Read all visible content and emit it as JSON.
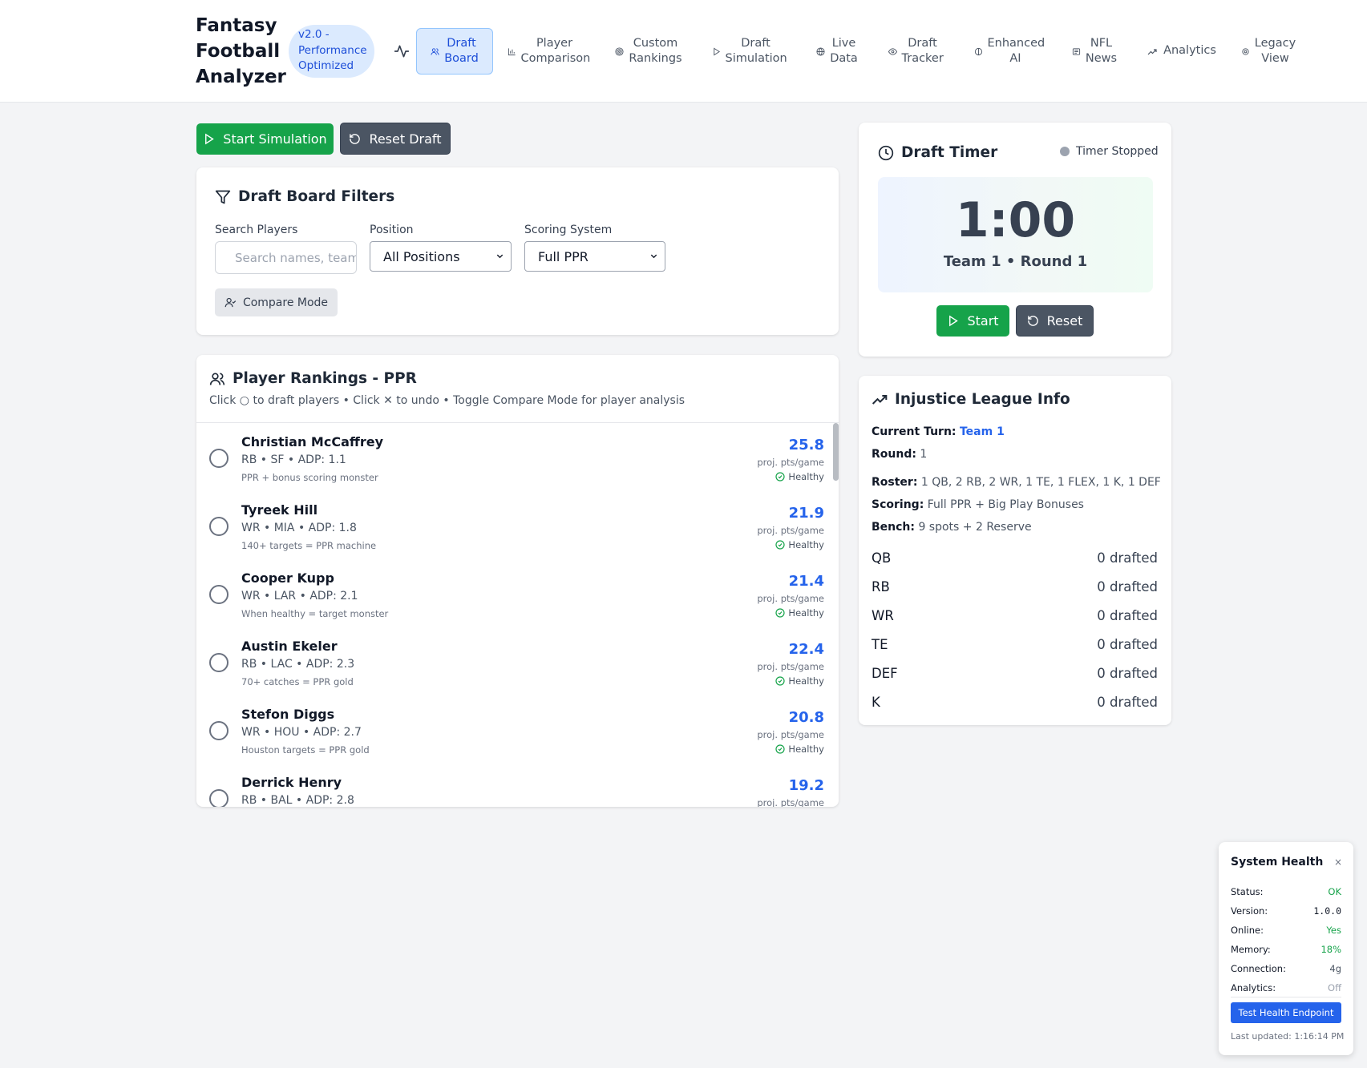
{
  "header": {
    "brand": "Fantasy Football Analyzer",
    "version": "v2.0 - Performance Optimized",
    "nav": [
      {
        "label": "Draft Board",
        "icon": "users-icon",
        "active": true
      },
      {
        "label": "Player Comparison",
        "icon": "bar-chart-icon"
      },
      {
        "label": "Custom Rankings",
        "icon": "target-icon"
      },
      {
        "label": "Draft Simulation",
        "icon": "play-icon"
      },
      {
        "label": "Live Data",
        "icon": "globe-icon"
      },
      {
        "label": "Draft Tracker",
        "icon": "eye-icon"
      },
      {
        "label": "Enhanced AI",
        "icon": "brain-icon"
      },
      {
        "label": "NFL News",
        "icon": "newspaper-icon"
      },
      {
        "label": "Analytics",
        "icon": "trending-up-icon"
      },
      {
        "label": "Legacy View",
        "icon": "settings-icon"
      }
    ]
  },
  "actions": {
    "start": "Start Simulation",
    "reset": "Reset Draft"
  },
  "filters": {
    "title": "Draft Board Filters",
    "search_label": "Search Players",
    "search_placeholder": "Search names, teams...",
    "position_label": "Position",
    "position_value": "All Positions",
    "scoring_label": "Scoring System",
    "scoring_value": "Full PPR",
    "compare": "Compare Mode"
  },
  "rankings": {
    "title": "Player Rankings - PPR",
    "subtitle": "Click ○ to draft players • Click ✕ to undo • Toggle Compare Mode for player analysis",
    "pts_label": "proj. pts/game",
    "players": [
      {
        "name": "Christian McCaffrey",
        "meta": "RB • SF • ADP: 1.1",
        "note": "PPR + bonus scoring monster",
        "pts": "25.8",
        "status": "Healthy"
      },
      {
        "name": "Tyreek Hill",
        "meta": "WR • MIA • ADP: 1.8",
        "note": "140+ targets = PPR machine",
        "pts": "21.9",
        "status": "Healthy"
      },
      {
        "name": "Cooper Kupp",
        "meta": "WR • LAR • ADP: 2.1",
        "note": "When healthy = target monster",
        "pts": "21.4",
        "status": "Healthy"
      },
      {
        "name": "Austin Ekeler",
        "meta": "RB • LAC • ADP: 2.3",
        "note": "70+ catches = PPR gold",
        "pts": "22.4",
        "status": "Healthy"
      },
      {
        "name": "Stefon Diggs",
        "meta": "WR • HOU • ADP: 2.7",
        "note": "Houston targets = PPR gold",
        "pts": "20.8",
        "status": "Healthy"
      },
      {
        "name": "Derrick Henry",
        "meta": "RB • BAL • ADP: 2.8",
        "note": "",
        "pts": "19.2",
        "status": ""
      }
    ]
  },
  "timer": {
    "title": "Draft Timer",
    "status": "Timer Stopped",
    "time": "1:00",
    "sub": "Team 1 • Round 1",
    "start": "Start",
    "reset": "Reset"
  },
  "league": {
    "title": "Injustice League Info",
    "turn_label": "Current Turn:",
    "turn_value": "Team 1",
    "round_label": "Round:",
    "round_value": "1",
    "roster_label": "Roster:",
    "roster_value": "1 QB, 2 RB, 2 WR, 1 TE, 1 FLEX, 1 K, 1 DEF",
    "scoring_label": "Scoring:",
    "scoring_value": "Full PPR + Big Play Bonuses",
    "bench_label": "Bench:",
    "bench_value": "9 spots + 2 Reserve",
    "positions": [
      {
        "pos": "QB",
        "value": "0 drafted"
      },
      {
        "pos": "RB",
        "value": "0 drafted"
      },
      {
        "pos": "WR",
        "value": "0 drafted"
      },
      {
        "pos": "TE",
        "value": "0 drafted"
      },
      {
        "pos": "DEF",
        "value": "0 drafted"
      },
      {
        "pos": "K",
        "value": "0 drafted"
      }
    ]
  },
  "system": {
    "title": "System Health",
    "close": "×",
    "rows": [
      {
        "label": "Status:",
        "value": "OK",
        "color": "#16a34a"
      },
      {
        "label": "Version:",
        "value": "1.0.0",
        "color": "#111827"
      },
      {
        "label": "Online:",
        "value": "Yes",
        "color": "#16a34a"
      },
      {
        "label": "Memory:",
        "value": "18%",
        "color": "#16a34a"
      },
      {
        "label": "Connection:",
        "value": "4g",
        "color": "#4b5563"
      },
      {
        "label": "Analytics:",
        "value": "Off",
        "color": "#9ca3af"
      }
    ],
    "button": "Test Health Endpoint",
    "updated": "Last updated: 1:16:14 PM"
  }
}
